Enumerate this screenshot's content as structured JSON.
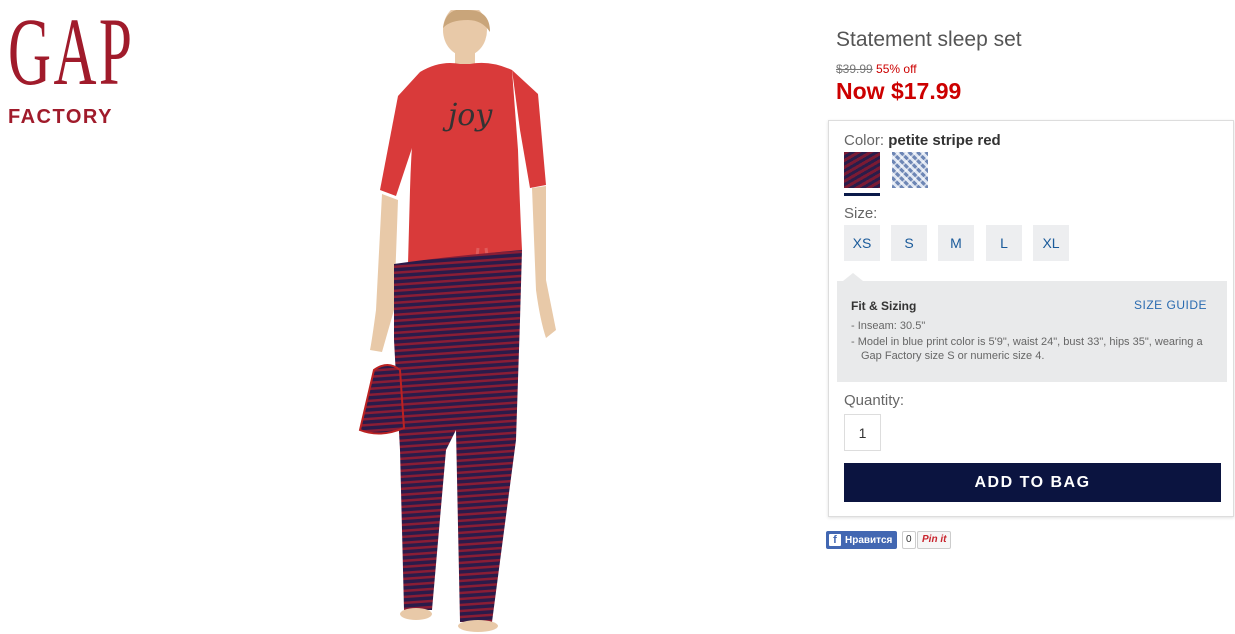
{
  "brand": {
    "logo_top": "GAP",
    "logo_bottom": "FACTORY",
    "color": "#a01b2b"
  },
  "product": {
    "title": "Statement sleep set",
    "was_price": "$39.99",
    "discount": "55% off",
    "now_price": "Now $17.99"
  },
  "options": {
    "color_label": "Color:",
    "color_value": "petite stripe red",
    "swatches": [
      {
        "name": "petite stripe red",
        "selected": true
      },
      {
        "name": "blue print",
        "selected": false
      }
    ],
    "size_label": "Size:",
    "sizes": [
      "XS",
      "S",
      "M",
      "L",
      "XL"
    ]
  },
  "fit": {
    "title": "Fit & Sizing",
    "size_guide": "SIZE GUIDE",
    "items": [
      "- Inseam: 30.5\"",
      "- Model in blue print color is 5'9\", waist 24\", bust 33\", hips 35\", wearing a Gap Factory size S or numeric size 4."
    ]
  },
  "quantity": {
    "label": "Quantity:",
    "value": "1"
  },
  "cart": {
    "add_label": "ADD TO BAG",
    "button_color": "#0b1440"
  },
  "social": {
    "facebook_label": "Нравится",
    "facebook_count": "0",
    "pinterest_label": "Pin it"
  },
  "colors": {
    "sale_red": "#cc0000",
    "link_blue": "#2a6bb0"
  }
}
